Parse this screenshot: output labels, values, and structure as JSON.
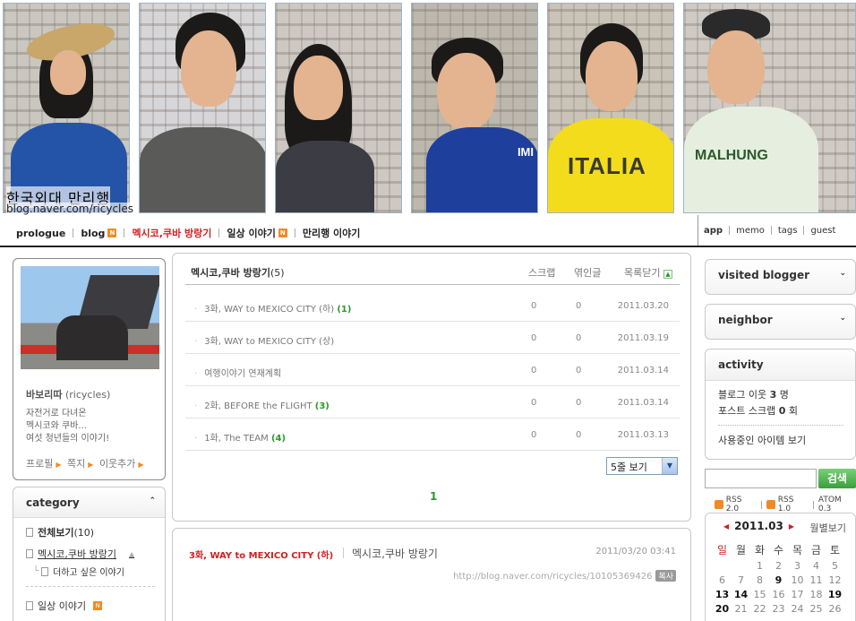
{
  "header": {
    "blog_title": "한국외대 만리행",
    "blog_url": "blog.naver.com/ricycles",
    "shirt_texts": [
      "ITALIA",
      "MALHUNG",
      "IMI"
    ]
  },
  "nav": {
    "left": [
      {
        "label": "prologue",
        "new": false,
        "active": false
      },
      {
        "label": "blog",
        "new": true,
        "active": false
      },
      {
        "label": "멕시코,쿠바 방랑기",
        "new": false,
        "active": true
      },
      {
        "label": "일상 이야기",
        "new": true,
        "active": false
      },
      {
        "label": "만리행 이야기",
        "new": false,
        "active": false
      }
    ],
    "right": [
      "app",
      "memo",
      "tags",
      "guest"
    ],
    "new_badge": "N"
  },
  "profile": {
    "nick": "바보리따",
    "id": "(ricycles)",
    "intro": [
      "자전거로 다녀온",
      "멕시코와 쿠바...",
      "여섯 청년들의 이야기!"
    ],
    "links": [
      "프로필",
      "쪽지",
      "이웃추가"
    ]
  },
  "category": {
    "title": "category",
    "items": [
      {
        "label": "전체보기",
        "count": "(10)"
      },
      {
        "label": "멕시코,쿠바 방랑기"
      },
      {
        "label": "더하고 싶은 이야기"
      },
      {
        "label": "일상 이야기"
      }
    ]
  },
  "postlist": {
    "title": "멕시코,쿠바 방랑기",
    "count": "(5)",
    "cols": {
      "scrap": "스크랩",
      "read": "엮인글",
      "close": "목록닫기"
    },
    "rows": [
      {
        "title": "3화, WAY to MEXICO CITY (하)",
        "comments": "(1)",
        "scrap": "0",
        "read": "0",
        "date": "2011.03.20"
      },
      {
        "title": "3화, WAY to MEXICO CITY (상)",
        "comments": "",
        "scrap": "0",
        "read": "0",
        "date": "2011.03.19"
      },
      {
        "title": "여행이야기 연재계획",
        "comments": "",
        "scrap": "0",
        "read": "0",
        "date": "2011.03.14"
      },
      {
        "title": "2화, BEFORE the FLIGHT",
        "comments": "(3)",
        "scrap": "0",
        "read": "0",
        "date": "2011.03.14"
      },
      {
        "title": "1화, The TEAM",
        "comments": "(4)",
        "scrap": "0",
        "read": "0",
        "date": "2011.03.13"
      }
    ],
    "per_page": "5줄 보기",
    "page": "1"
  },
  "post": {
    "title": "3화, WAY to MEXICO CITY (하)",
    "category": "멕시코,쿠바 방랑기",
    "date": "2011/03/20 03:41",
    "url": "http://blog.naver.com/ricycles/10105369426",
    "copy": "복사"
  },
  "right": {
    "visited": "visited blogger",
    "neighbor": "neighbor",
    "activity": {
      "title": "activity",
      "line1_label": "블로그 이웃",
      "line1_value": "3",
      "line1_unit": "명",
      "line2_label": "포스트 스크랩",
      "line2_value": "0",
      "line2_unit": "회",
      "line3": "사용중인 아이템 보기"
    },
    "search_button": "검색",
    "rss": [
      "RSS 2.0",
      "RSS 1.0",
      "ATOM 0.3"
    ],
    "calendar": {
      "month": "2011.03",
      "close": "월별보기",
      "dow": [
        "일",
        "월",
        "화",
        "수",
        "목",
        "금",
        "토"
      ],
      "rows": [
        [
          "",
          "",
          "1",
          "2",
          "3",
          "4",
          "5"
        ],
        [
          "6",
          "7",
          "8",
          "9",
          "10",
          "11",
          "12"
        ],
        [
          "13",
          "14",
          "15",
          "16",
          "17",
          "18",
          "19"
        ],
        [
          "20",
          "21",
          "22",
          "23",
          "24",
          "25",
          "26"
        ]
      ],
      "bold_days": [
        "9",
        "13",
        "14",
        "19",
        "20"
      ]
    }
  },
  "colors": {
    "accent_red": "#d02020",
    "green": "#2a9a2a",
    "orange": "#f08a24"
  }
}
